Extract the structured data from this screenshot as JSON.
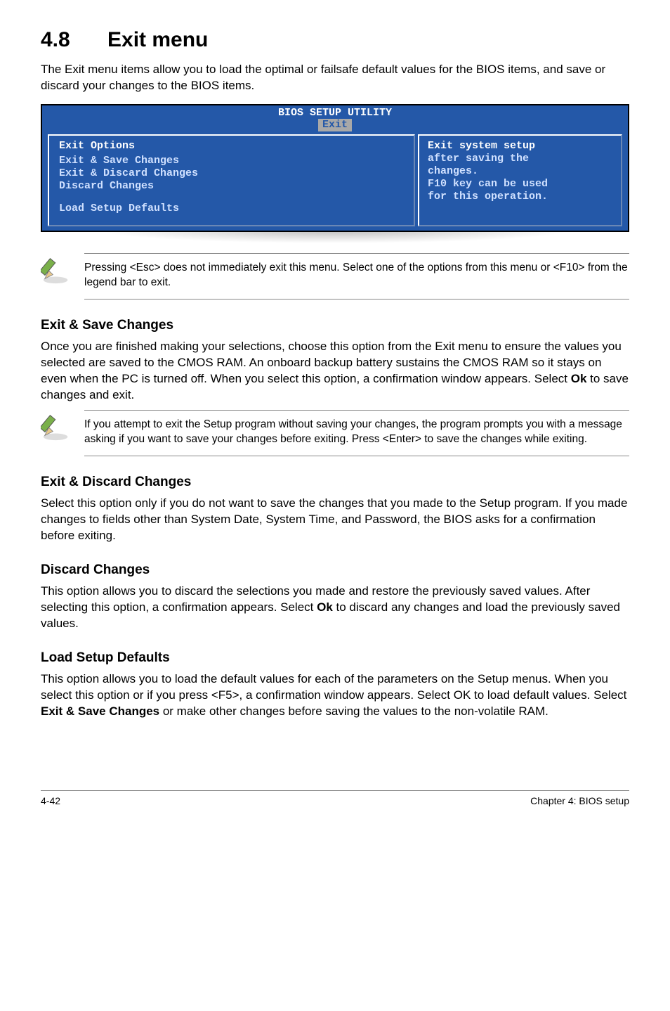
{
  "heading": {
    "num": "4.8",
    "title": "Exit menu"
  },
  "intro": "The Exit menu items allow you to load the optimal or failsafe default values for the BIOS items, and save or discard your changes to the BIOS items.",
  "bios": {
    "header": "BIOS SETUP UTILITY",
    "tab": "Exit",
    "left_title": "Exit Options",
    "items": [
      "Exit & Save Changes",
      "Exit & Discard Changes",
      "Discard Changes",
      "Load Setup Defaults"
    ],
    "right_lines": [
      "Exit system setup",
      "after saving the",
      "changes.",
      "",
      "F10 key can be used",
      "for this operation."
    ]
  },
  "note1": "Pressing <Esc> does not immediately exit this menu. Select one of the options from this menu or <F10> from the legend bar to exit.",
  "sec1": {
    "title": "Exit & Save Changes",
    "body": "Once you are finished making your selections, choose this option from the Exit menu to ensure the values you selected are saved to the CMOS RAM. An onboard backup battery sustains the CMOS RAM so it stays on even when the PC is turned off. When you select this option, a confirmation window appears. Select Ok to save changes and exit."
  },
  "note2": " If you attempt to exit the Setup program without saving your changes, the program prompts you with a message asking if you want to save your changes before exiting. Press <Enter> to save the  changes while exiting.",
  "sec2": {
    "title": "Exit & Discard Changes",
    "body": "Select this option only if you do not want to save the changes that you  made to the Setup program. If you made changes to fields other than System Date, System Time, and Password, the BIOS asks for a confirmation before exiting."
  },
  "sec3": {
    "title": "Discard Changes",
    "body": "This option allows you to discard the selections you made and restore the previously saved values. After selecting this option, a confirmation appears. Select Ok to discard any changes and load the previously saved values."
  },
  "sec4": {
    "title": "Load Setup Defaults",
    "body": "This option allows you to load the default values for each of the parameters on the Setup menus. When you select this option or if you press <F5>, a confirmation window appears. Select OK to load default values. Select Exit & Save Changes or make other changes before saving the values to the non-volatile RAM."
  },
  "footer": {
    "left": "4-42",
    "right": "Chapter 4: BIOS setup"
  }
}
